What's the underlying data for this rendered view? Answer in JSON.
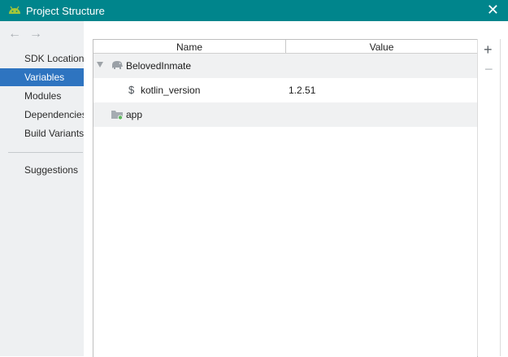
{
  "window": {
    "title": "Project Structure",
    "close_glyph": "✕",
    "icon": "android-icon",
    "accent_color": "#00858c"
  },
  "nav": {
    "back_glyph": "←",
    "forward_glyph": "→"
  },
  "sidebar": {
    "items": [
      {
        "label": "SDK Location",
        "selected": false
      },
      {
        "label": "Variables",
        "selected": true
      },
      {
        "label": "Modules",
        "selected": false
      },
      {
        "label": "Dependencies",
        "selected": false
      },
      {
        "label": "Build Variants",
        "selected": false
      }
    ],
    "secondary": [
      {
        "label": "Suggestions"
      }
    ],
    "selected_color": "#2e74c0"
  },
  "table": {
    "columns": [
      "Name",
      "Value"
    ],
    "rows": [
      {
        "name": "BelovedInmate",
        "value": "",
        "icon": "gradle-elephant-icon",
        "expanded": true
      },
      {
        "name": "kotlin_version",
        "value": "1.2.51",
        "icon": "dollar-variable-icon",
        "child": true
      },
      {
        "name": "app",
        "value": "",
        "icon": "module-folder-icon"
      }
    ]
  },
  "toolbar": {
    "add_glyph": "+",
    "remove_glyph": "−"
  }
}
